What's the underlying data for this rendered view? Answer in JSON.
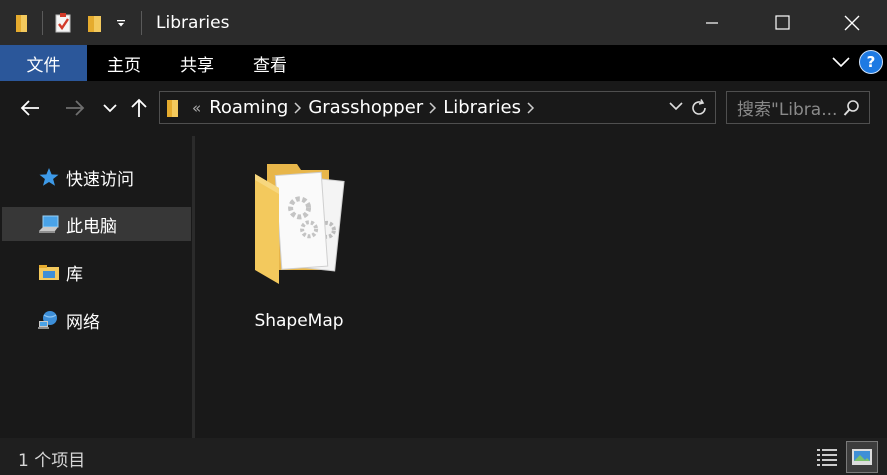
{
  "window": {
    "title": "Libraries",
    "controls": {
      "minimize": "minimize",
      "maximize": "maximize",
      "close": "close"
    }
  },
  "ribbon": {
    "tabs": [
      {
        "label": "文件",
        "active": true
      },
      {
        "label": "主页"
      },
      {
        "label": "共享"
      },
      {
        "label": "查看"
      }
    ]
  },
  "address": {
    "overflow": "«",
    "crumbs": [
      "Roaming",
      "Grasshopper",
      "Libraries"
    ]
  },
  "search": {
    "placeholder": "搜索\"Libra..."
  },
  "sidebar": {
    "items": [
      {
        "label": "快速访问",
        "icon": "star-icon"
      },
      {
        "label": "此电脑",
        "icon": "computer-icon",
        "selected": true
      },
      {
        "label": "库",
        "icon": "library-icon"
      },
      {
        "label": "网络",
        "icon": "network-icon"
      }
    ]
  },
  "content": {
    "items": [
      {
        "name": "ShapeMap",
        "icon": "folder-icon"
      }
    ]
  },
  "status": {
    "text": "1 个项目"
  },
  "colors": {
    "accent": "#2b579a",
    "help": "#1e7ae3",
    "selected_bg": "#373737"
  }
}
